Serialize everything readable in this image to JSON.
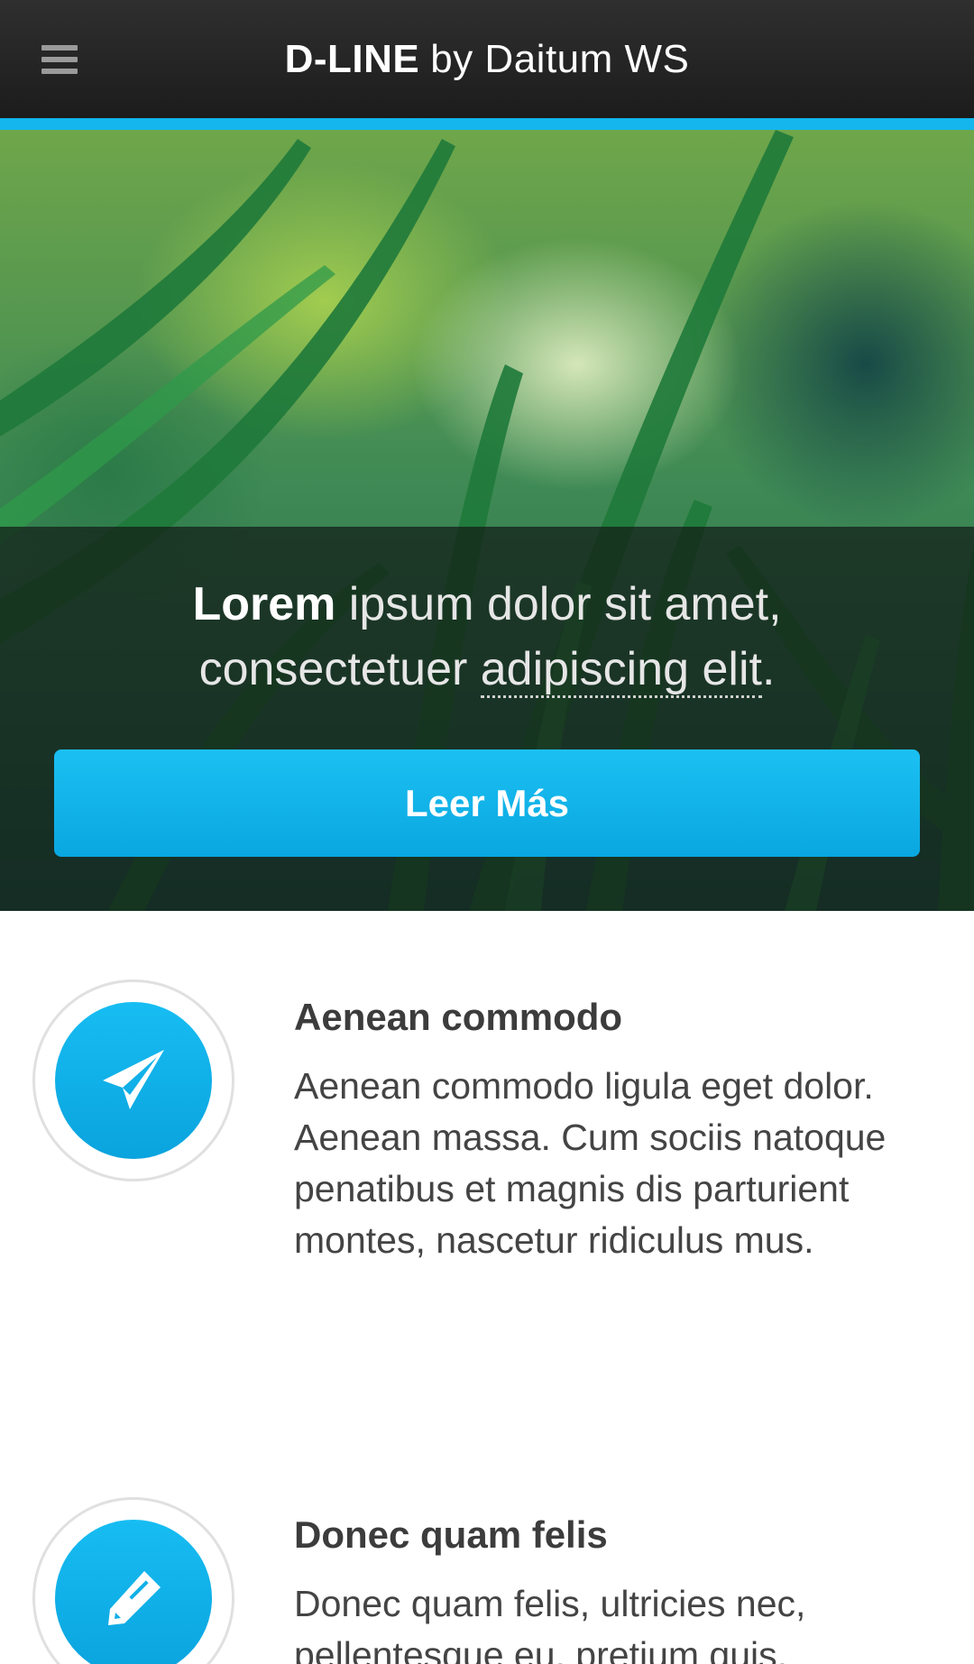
{
  "header": {
    "menu_icon": "hamburger-menu-icon",
    "brand_bold": "D-LINE",
    "brand_rest": "by Daitum WS",
    "accent_color": "#14b6ee"
  },
  "hero": {
    "tagline_strong": "Lorem",
    "tagline_part1": " ipsum dolor sit amet,",
    "tagline_part2": "consectetuer ",
    "tagline_abbr": "adipiscing elit",
    "tagline_end": ".",
    "cta_label": "Leer Más"
  },
  "features": [
    {
      "icon": "paper-plane-icon",
      "title": "Aenean commodo",
      "text": "Aenean commodo ligula eget dolor. Aenean massa. Cum sociis natoque penatibus et magnis dis parturient montes, nascetur ridiculus mus."
    },
    {
      "icon": "pencil-icon",
      "title": "Donec quam felis",
      "text": "Donec quam felis, ultricies nec, pellentesque eu, pretium quis,"
    }
  ]
}
